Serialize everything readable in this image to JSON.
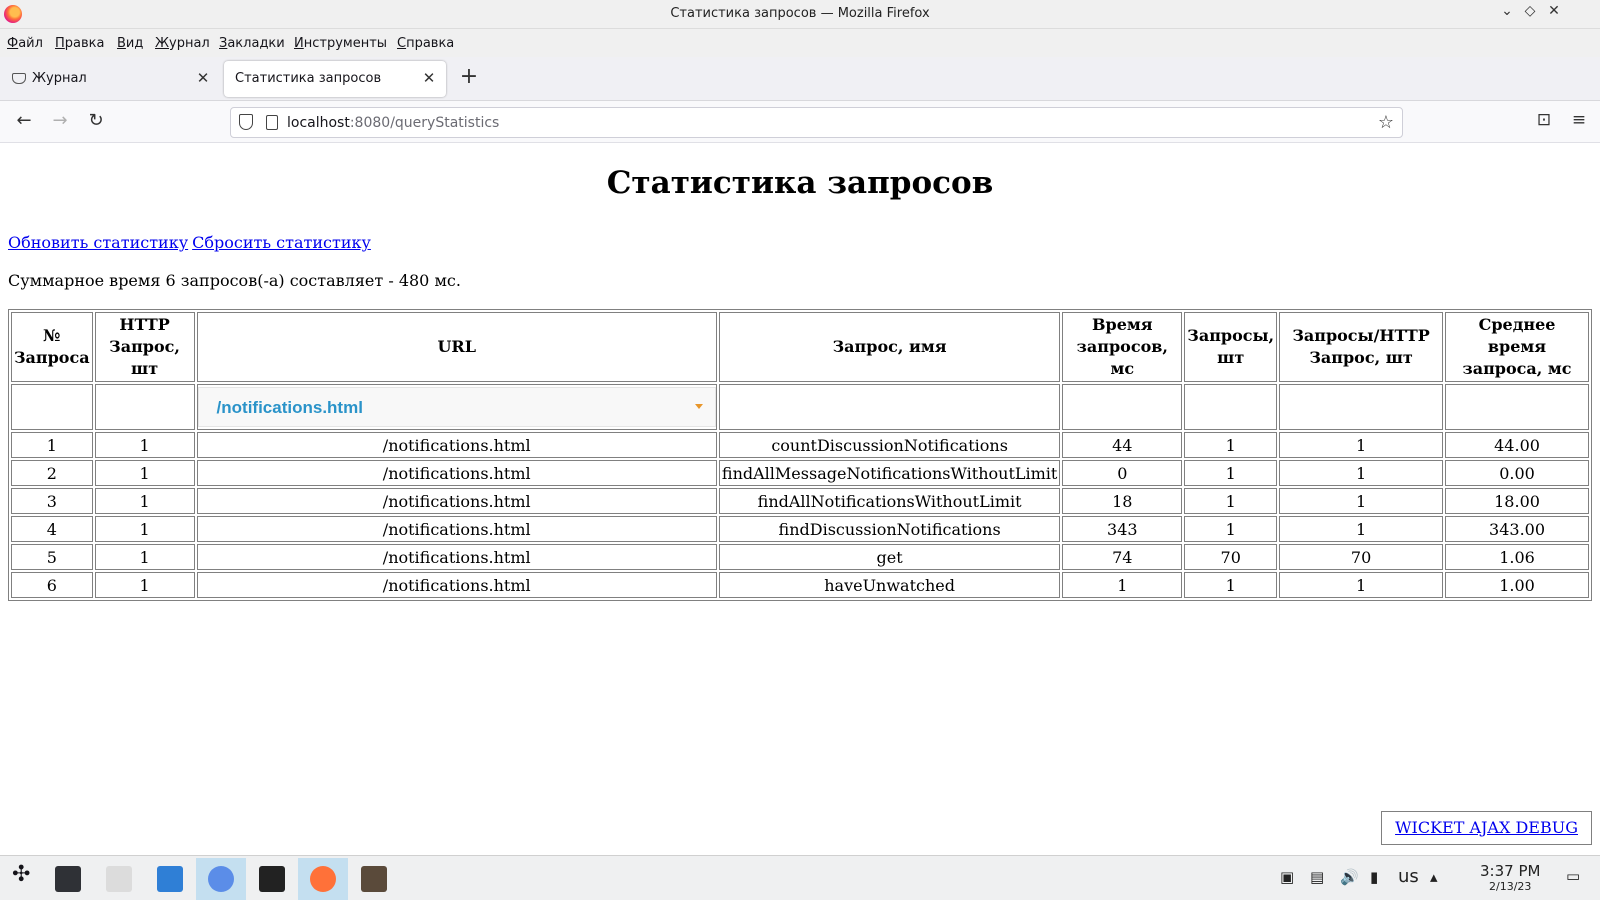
{
  "window": {
    "title": "Статистика запросов — Mozilla Firefox",
    "controls": [
      "⌄",
      "◇",
      "✕"
    ]
  },
  "menu": {
    "items": [
      {
        "u": "Ф",
        "rest": "айл"
      },
      {
        "u": "П",
        "rest": "равка"
      },
      {
        "u": "В",
        "rest": "ид"
      },
      {
        "u": "Ж",
        "rest": "урнал"
      },
      {
        "u": "З",
        "rest": "акладки"
      },
      {
        "u": "И",
        "rest": "нструменты"
      },
      {
        "u": "С",
        "rest": "правка"
      }
    ]
  },
  "tabs": [
    {
      "label": "Журнал",
      "icon": "pocket-icon"
    },
    {
      "label": "Статистика запросов",
      "icon": ""
    }
  ],
  "tab_close": "✕",
  "new_tab": "+",
  "nav": {
    "back": "←",
    "forward": "→",
    "reload": "↻",
    "url_host": "localhost",
    "url_rest": ":8080/queryStatistics",
    "star": "☆",
    "pocket": "⊡",
    "menu": "≡"
  },
  "page": {
    "heading": "Статистика запросов",
    "refresh_link": "Обновить статистику",
    "reset_link": "Сбросить статистику",
    "summary": "Суммарное время 6 запросов(-а) составляет - 480 мс.",
    "columns": [
      [
        "№",
        "Запроса"
      ],
      [
        "HTTP",
        "Запрос, шт"
      ],
      [
        "URL"
      ],
      [
        "Запрос, имя"
      ],
      [
        "Время",
        "запросов, мс"
      ],
      [
        "Запросы,",
        "шт"
      ],
      [
        "Запросы/HTTP",
        "Запрос, шт"
      ],
      [
        "Среднее время",
        "запроса, мс"
      ]
    ],
    "url_filter": "/notifications.html",
    "rows": [
      [
        "1",
        "1",
        "/notifications.html",
        "countDiscussionNotifications",
        "44",
        "1",
        "1",
        "44.00"
      ],
      [
        "2",
        "1",
        "/notifications.html",
        "findAllMessageNotificationsWithoutLimit",
        "0",
        "1",
        "1",
        "0.00"
      ],
      [
        "3",
        "1",
        "/notifications.html",
        "findAllNotificationsWithoutLimit",
        "18",
        "1",
        "1",
        "18.00"
      ],
      [
        "4",
        "1",
        "/notifications.html",
        "findDiscussionNotifications",
        "343",
        "1",
        "1",
        "343.00"
      ],
      [
        "5",
        "1",
        "/notifications.html",
        "get",
        "74",
        "70",
        "70",
        "1.06"
      ],
      [
        "6",
        "1",
        "/notifications.html",
        "haveUnwatched",
        "1",
        "1",
        "1",
        "1.00"
      ]
    ],
    "debug_link": "WICKET AJAX DEBUG"
  },
  "taskbar": {
    "apps": [
      {
        "name": "launcher",
        "color": "#3b3b3b",
        "active": false
      },
      {
        "name": "settings",
        "color": "#2f3136",
        "active": false
      },
      {
        "name": "files",
        "color": "#dcdcdc",
        "active": false
      },
      {
        "name": "file-manager",
        "color": "#2f7fd6",
        "active": false
      },
      {
        "name": "chromium",
        "color": "#5b8de8",
        "active": true
      },
      {
        "name": "intellij",
        "color": "#222222",
        "active": false
      },
      {
        "name": "firefox",
        "color": "#ff7139",
        "active": true
      },
      {
        "name": "dbeaver",
        "color": "#5a4a3a",
        "active": false
      }
    ],
    "keyboard": "us",
    "time": "3:37 PM",
    "date": "2/13/23"
  }
}
